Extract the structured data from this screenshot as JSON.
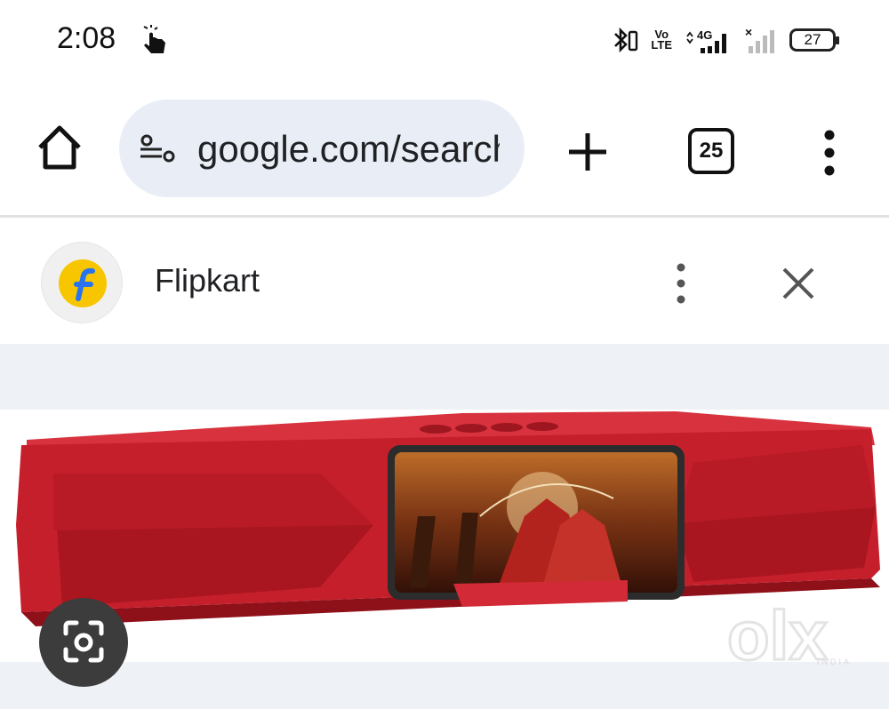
{
  "status_bar": {
    "time": "2:08",
    "volte_line1": "Vo",
    "volte_line2": "LTE",
    "network": "4G",
    "sim2": "×",
    "battery": "27"
  },
  "toolbar": {
    "url": "google.com/search",
    "tab_count": "25"
  },
  "source": {
    "name": "Flipkart",
    "logo_letter": "f"
  },
  "image": {
    "watermark": "olx",
    "watermark_sub": "INDIA"
  },
  "colors": {
    "omnibox_bg": "#e9eef6",
    "flipkart_yellow": "#f7c600",
    "flipkart_blue": "#2874f0",
    "speaker_red": "#c81e2e",
    "lens_button": "#3c3c3c"
  },
  "icons": [
    "touch-gesture-icon",
    "bluetooth-icon",
    "signal-icon",
    "battery-icon",
    "home-icon",
    "tune-icon",
    "plus-icon",
    "tab-switcher-icon",
    "more-vert-icon",
    "close-icon",
    "lens-icon"
  ]
}
